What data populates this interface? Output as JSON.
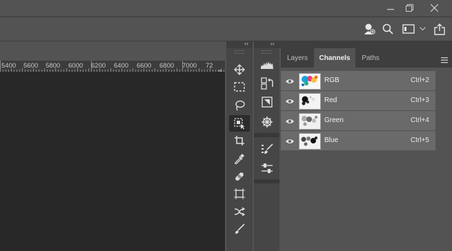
{
  "window": {
    "minimize_icon": "minimize-icon",
    "restore_icon": "restore-icon",
    "close_icon": "close-icon"
  },
  "options_bar": {
    "icons": [
      "learn-icon",
      "search-icon",
      "workspace-icon",
      "chevron-down-icon",
      "share-icon"
    ]
  },
  "ruler": {
    "ticks": [
      "5400",
      "5600",
      "5800",
      "6000",
      "6200",
      "6400",
      "6600",
      "6800",
      "7000",
      "72"
    ]
  },
  "panels": {
    "collapse_left": "‹‹",
    "collapse_right": "‹‹"
  },
  "tools": [
    "move-tool",
    "marquee-tool",
    "lasso-tool",
    "object-selection-tool",
    "crop-tool",
    "eyedropper-tool",
    "healing-brush-tool",
    "frame-tool",
    "patch-tool",
    "brush-tool"
  ],
  "side_icons": [
    "histogram",
    "history",
    "properties",
    "navigator",
    "brush-settings",
    "adjustments"
  ],
  "channels_panel": {
    "tabs": [
      "Layers",
      "Channels",
      "Paths"
    ],
    "active_tab": "Channels",
    "rows": [
      {
        "name": "RGB",
        "shortcut": "Ctrl+2"
      },
      {
        "name": "Red",
        "shortcut": "Ctrl+3"
      },
      {
        "name": "Green",
        "shortcut": "Ctrl+4"
      },
      {
        "name": "Blue",
        "shortcut": "Ctrl+5"
      }
    ]
  },
  "colors": {
    "workspace_bg": "#535353",
    "canvas_bg": "#282828",
    "panel_row": "#6a6a6a",
    "tab_bar": "#3e3e3e"
  }
}
